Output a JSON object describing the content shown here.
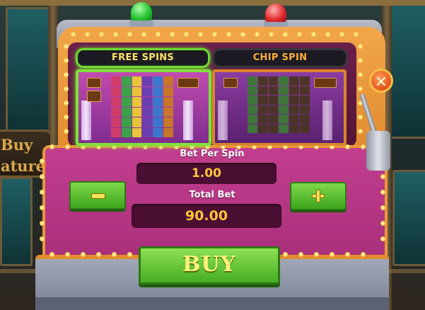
{
  "tabs": [
    {
      "label": "FREE SPINS",
      "selected": true
    },
    {
      "label": "CHIP SPIN",
      "selected": false
    }
  ],
  "side_sign": {
    "text": "Buy\nature"
  },
  "bet_per_spin": {
    "label": "Bet Per Spin",
    "value": "1.00"
  },
  "total_bet": {
    "label": "Total Bet",
    "value": "90.00"
  },
  "buy_button": {
    "label": "BUY"
  },
  "icons": {
    "close": "close-icon",
    "decrease": "minus-icon",
    "increase": "plus-icon",
    "beacon_left": "green-beacon-icon",
    "beacon_right": "red-beacon-icon"
  },
  "colors": {
    "frame": "#e08a2e",
    "panel": "#b2357f",
    "value_text": "#ffc53a",
    "button_green": "#5cc32e",
    "selected_glow": "#7ee23a"
  }
}
